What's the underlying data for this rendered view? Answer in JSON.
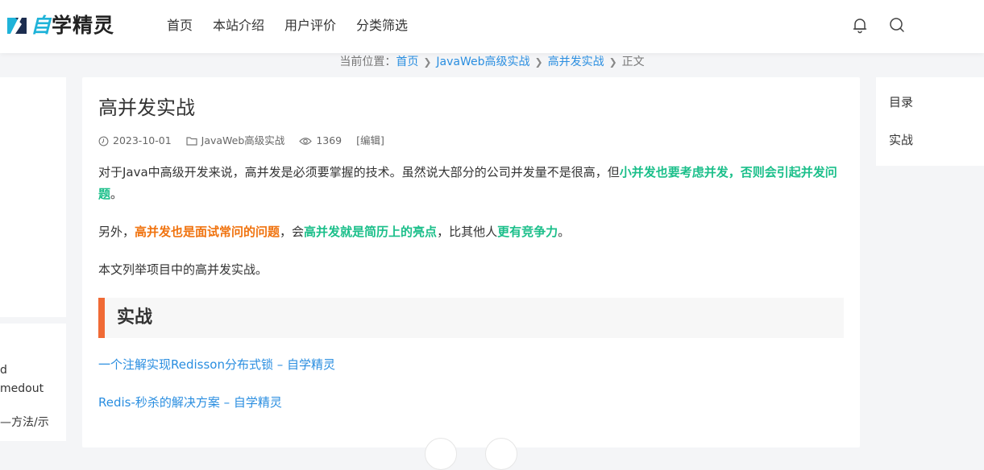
{
  "header": {
    "logo_first": "自",
    "logo_rest": "学精灵",
    "nav": [
      "首页",
      "本站介绍",
      "用户评价",
      "分类筛选"
    ],
    "icons": [
      "bell-icon",
      "search-icon"
    ]
  },
  "breadcrumb": {
    "prefix": "当前位置：",
    "items": [
      "首页",
      "JavaWeb高级实战",
      "高并发实战"
    ],
    "current": "正文"
  },
  "left_sidebar": {
    "lines": [
      "d",
      "medout",
      "—方法/示"
    ]
  },
  "article": {
    "title": "高并发实战",
    "meta": {
      "date": "2023-10-01",
      "category": "JavaWeb高级实战",
      "views": "1369",
      "edit": "[编辑]"
    },
    "p1": {
      "text": "对于Java中高级开发来说，高并发是必须要掌握的技术。虽然说大部分的公司并发量不是很高，但",
      "highlight": "小并发也要考虑并发，否则会引起并发问题",
      "end": "。"
    },
    "p2": {
      "a": "另外，",
      "b": "高并发也是面试常问的问题",
      "c": "，会",
      "d": "高并发就是简历上的亮点",
      "e": "，比其他人",
      "f": "更有竞争力",
      "g": "。"
    },
    "p3": "本文列举项目中的高并发实战。",
    "heading": "实战",
    "links": [
      "一个注解实现Redisson分布式锁 – 自学精灵",
      "Redis-秒杀的解决方案 – 自学精灵"
    ]
  },
  "toc": {
    "items": [
      "目录",
      "实战"
    ]
  },
  "colors": {
    "accent_green": "#1bbf8a",
    "accent_orange": "#f0730f",
    "link_blue": "#2a8ee0",
    "heading_bar": "#f06a35"
  }
}
